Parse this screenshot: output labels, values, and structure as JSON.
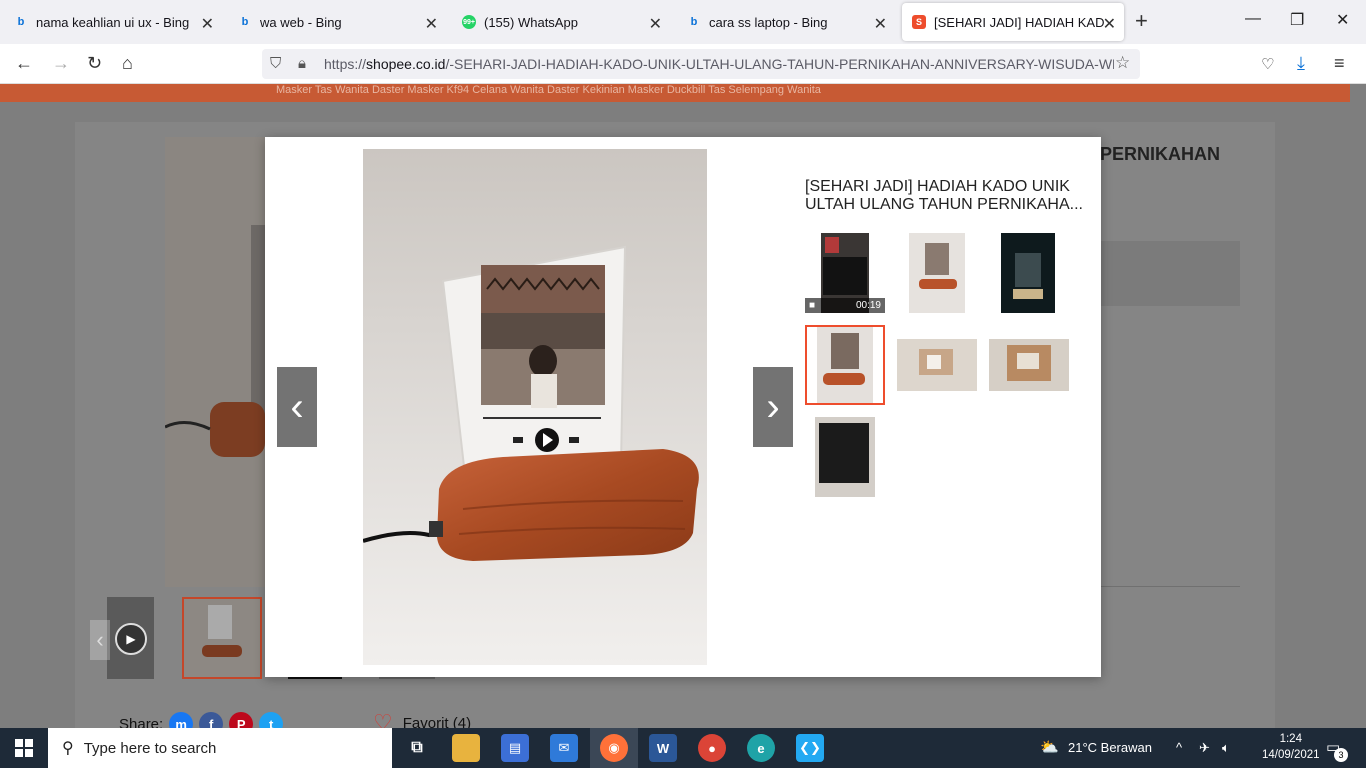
{
  "browser": {
    "tabs": [
      {
        "label": "nama keahlian ui ux - Bing",
        "icon": "bing-icon"
      },
      {
        "label": "wa web - Bing",
        "icon": "bing-icon"
      },
      {
        "label": "(155) WhatsApp",
        "icon": "whatsapp-icon",
        "badge": "99+"
      },
      {
        "label": "cara ss laptop - Bing",
        "icon": "bing-icon"
      },
      {
        "label": "[SEHARI JADI] HADIAH KADO U",
        "icon": "shopee-icon",
        "active": true
      }
    ],
    "url_prefix": "https://",
    "url_domain": "shopee.co.id",
    "url_path": "/-SEHARI-JADI-HADIAH-KADO-UNIK-ULTAH-ULANG-TAHUN-PERNIKAHAN-ANNIVERSARY-WISUDA-WEDD"
  },
  "page": {
    "category_links": "Masker    Tas Wanita    Daster    Masker Kf94    Celana Wanita    Daster Kekinian    Masker Duckbill    Tas Selempang Wanita",
    "behind_title": "PERNIKAHAN",
    "share_label": "Share:",
    "favorite_label": "Favorit (4)"
  },
  "modal": {
    "title": "[SEHARI JADI] HADIAH KADO UNIK ULTAH ULANG TAHUN PERNIKAHA...",
    "video_duration": "00:19",
    "prev_label": "‹",
    "next_label": "›",
    "thumbnails": [
      {
        "name": "thumb-video",
        "kind": "video"
      },
      {
        "name": "thumb-2",
        "kind": "image"
      },
      {
        "name": "thumb-3",
        "kind": "image"
      },
      {
        "name": "thumb-4",
        "kind": "image",
        "selected": true
      },
      {
        "name": "thumb-5",
        "kind": "image"
      },
      {
        "name": "thumb-6",
        "kind": "image"
      },
      {
        "name": "thumb-7",
        "kind": "image"
      }
    ]
  },
  "taskbar": {
    "search_placeholder": "Type here to search",
    "weather": "21°C  Berawan",
    "time": "1:24",
    "date": "14/09/2021",
    "notification_count": "3"
  },
  "colors": {
    "accent": "#ee4d2d",
    "taskbar": "#1e2a38",
    "wood": "#b8522a"
  }
}
